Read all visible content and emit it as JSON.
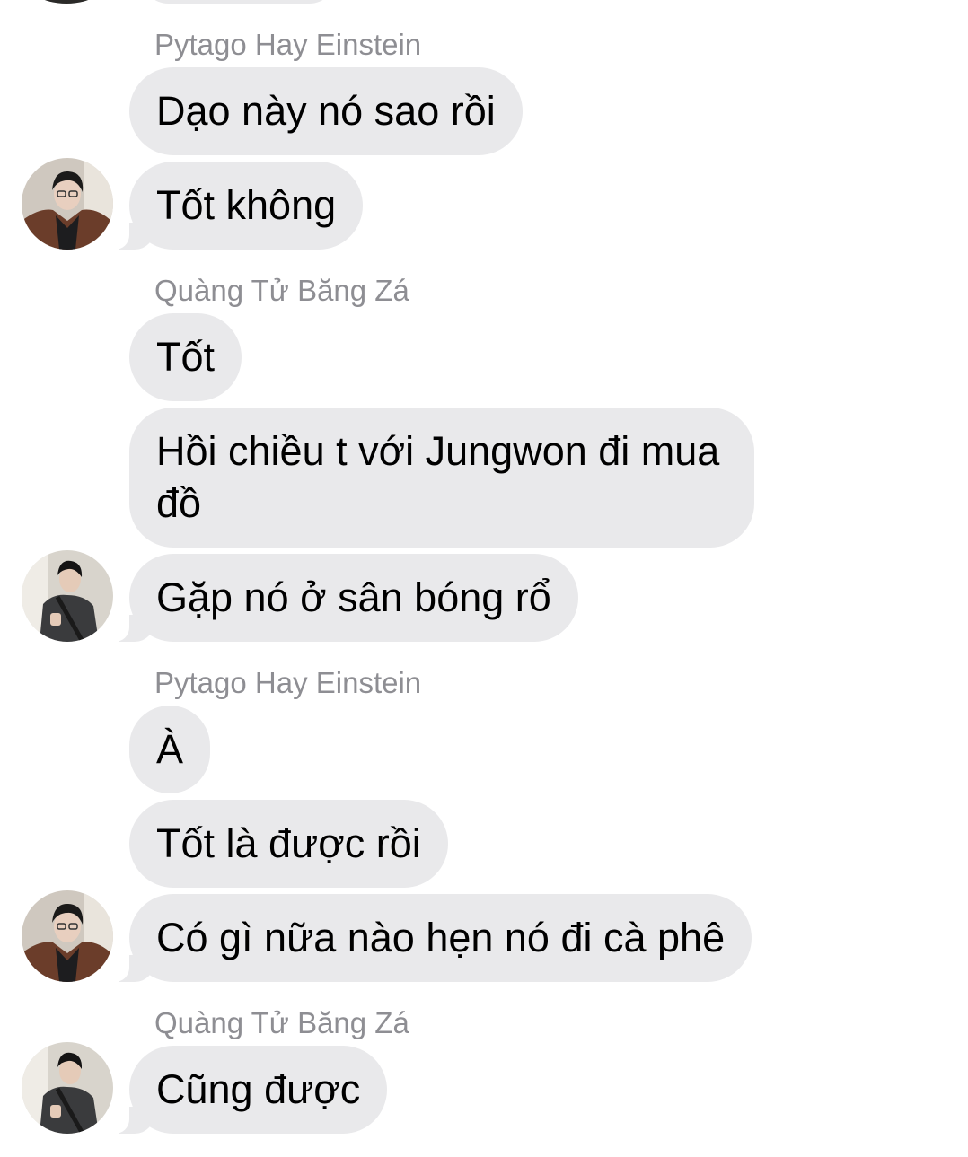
{
  "chat": {
    "colors": {
      "bubble": "#e9e9eb",
      "sender_name": "#8e8e93",
      "text": "#000000",
      "background": "#ffffff"
    },
    "messages": [
      {
        "sender": "Pytago Hay Einstein",
        "texts": [
          "Dạo này nó sao rồi",
          "Tốt không"
        ],
        "avatar": "avatar-brown-jacket-icon"
      },
      {
        "sender": "Quàng Tử Băng Zá",
        "texts": [
          "Tốt",
          "Hồi chiều t với Jungwon đi mua đồ",
          "Gặp nó ở sân bóng rổ"
        ],
        "avatar": "avatar-dark-coat-icon"
      },
      {
        "sender": "Pytago Hay Einstein",
        "texts": [
          "À",
          "Tốt là được rồi",
          "Có gì nữa nào hẹn nó đi cà phê"
        ],
        "avatar": "avatar-brown-jacket-icon"
      },
      {
        "sender": "Quàng Tử Băng Zá",
        "texts": [
          "Cũng được"
        ],
        "avatar": "avatar-dark-coat-icon"
      }
    ]
  }
}
